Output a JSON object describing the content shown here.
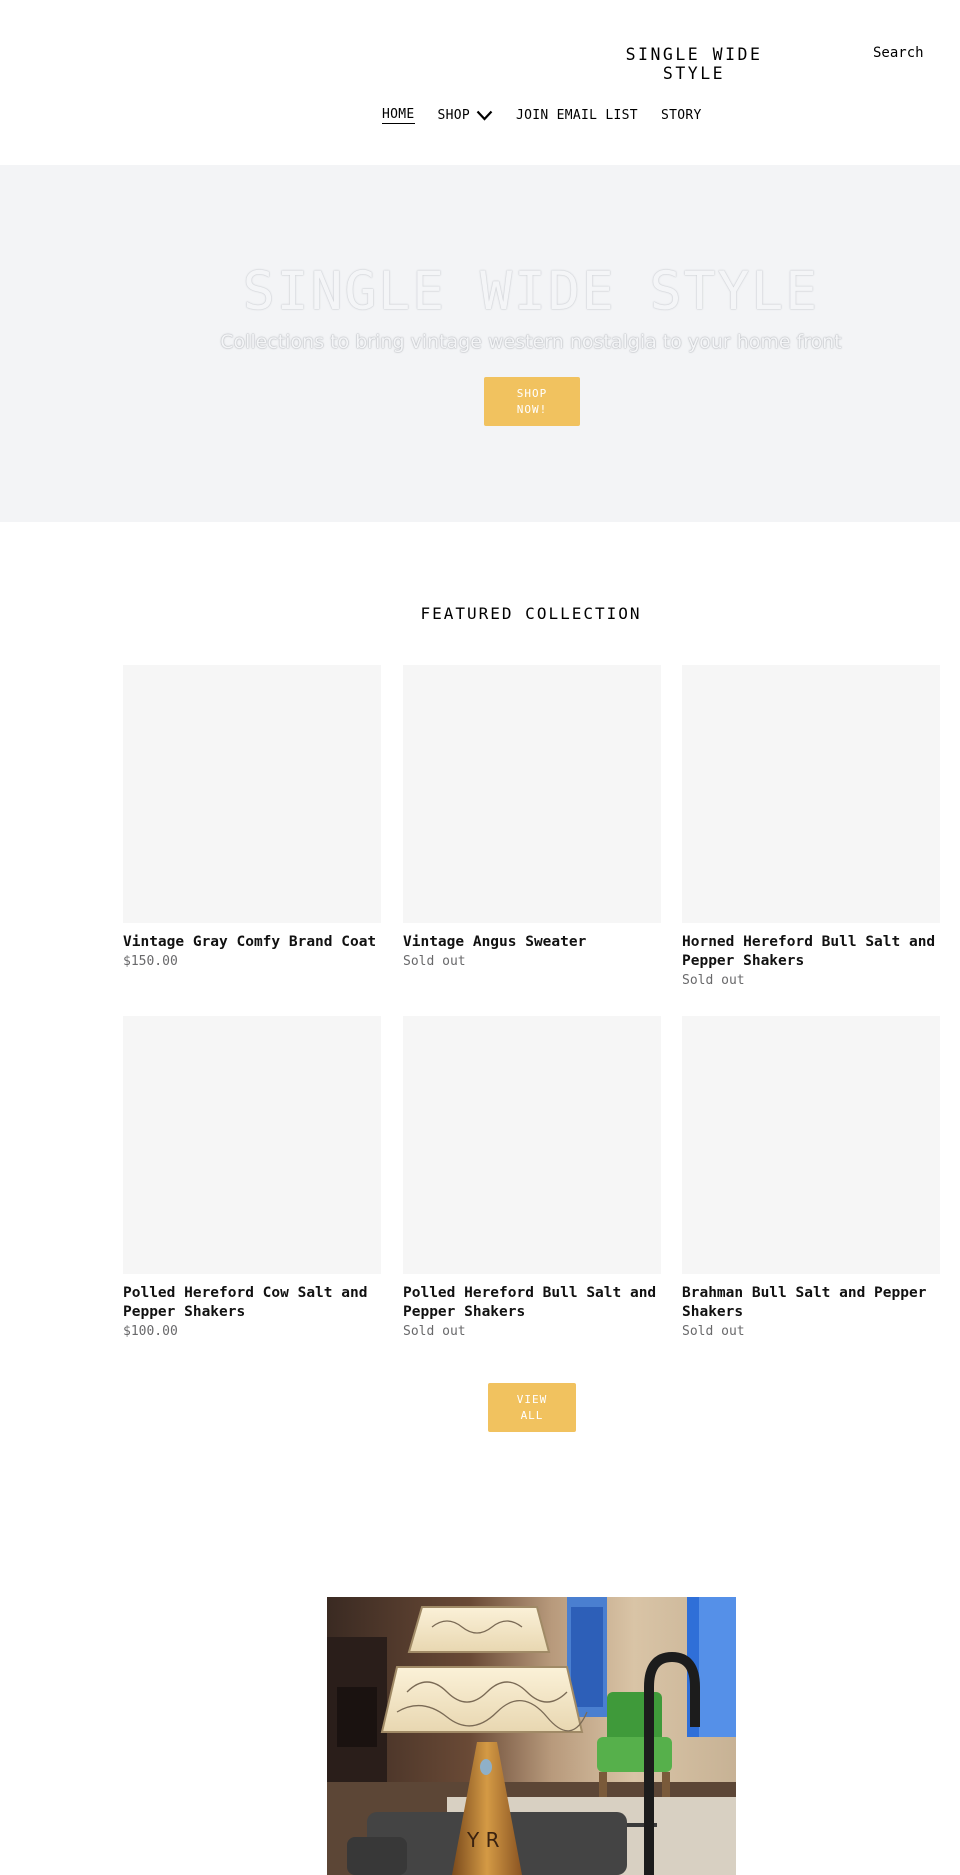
{
  "header": {
    "logo": "SINGLE WIDE STYLE",
    "search_label": "Search",
    "nav": [
      {
        "label": "HOME"
      },
      {
        "label": "SHOP"
      },
      {
        "label": "JOIN EMAIL LIST"
      },
      {
        "label": "STORY"
      }
    ]
  },
  "hero": {
    "title": "SINGLE WIDE STYLE",
    "subtitle": "Collections to bring vintage western nostalgia to your home front",
    "button_label": "SHOP NOW!"
  },
  "featured": {
    "title": "FEATURED COLLECTION",
    "products": [
      {
        "name": "Vintage Gray Comfy Brand Coat",
        "price": "$150.00"
      },
      {
        "name": "Vintage Angus Sweater",
        "price": "Sold out"
      },
      {
        "name": "Horned Hereford Bull Salt and Pepper Shakers",
        "price": "Sold out"
      },
      {
        "name": "Polled Hereford Cow Salt and Pepper Shakers",
        "price": "$100.00"
      },
      {
        "name": "Polled Hereford Bull Salt and Pepper Shakers",
        "price": "Sold out"
      },
      {
        "name": "Brahman Bull Salt and Pepper Shakers",
        "price": "Sold out"
      }
    ],
    "view_all_label": "VIEW ALL"
  },
  "colors": {
    "accent": "#f1c25f",
    "hero_bg": "#f3f4f6",
    "placeholder": "#f6f6f6"
  }
}
